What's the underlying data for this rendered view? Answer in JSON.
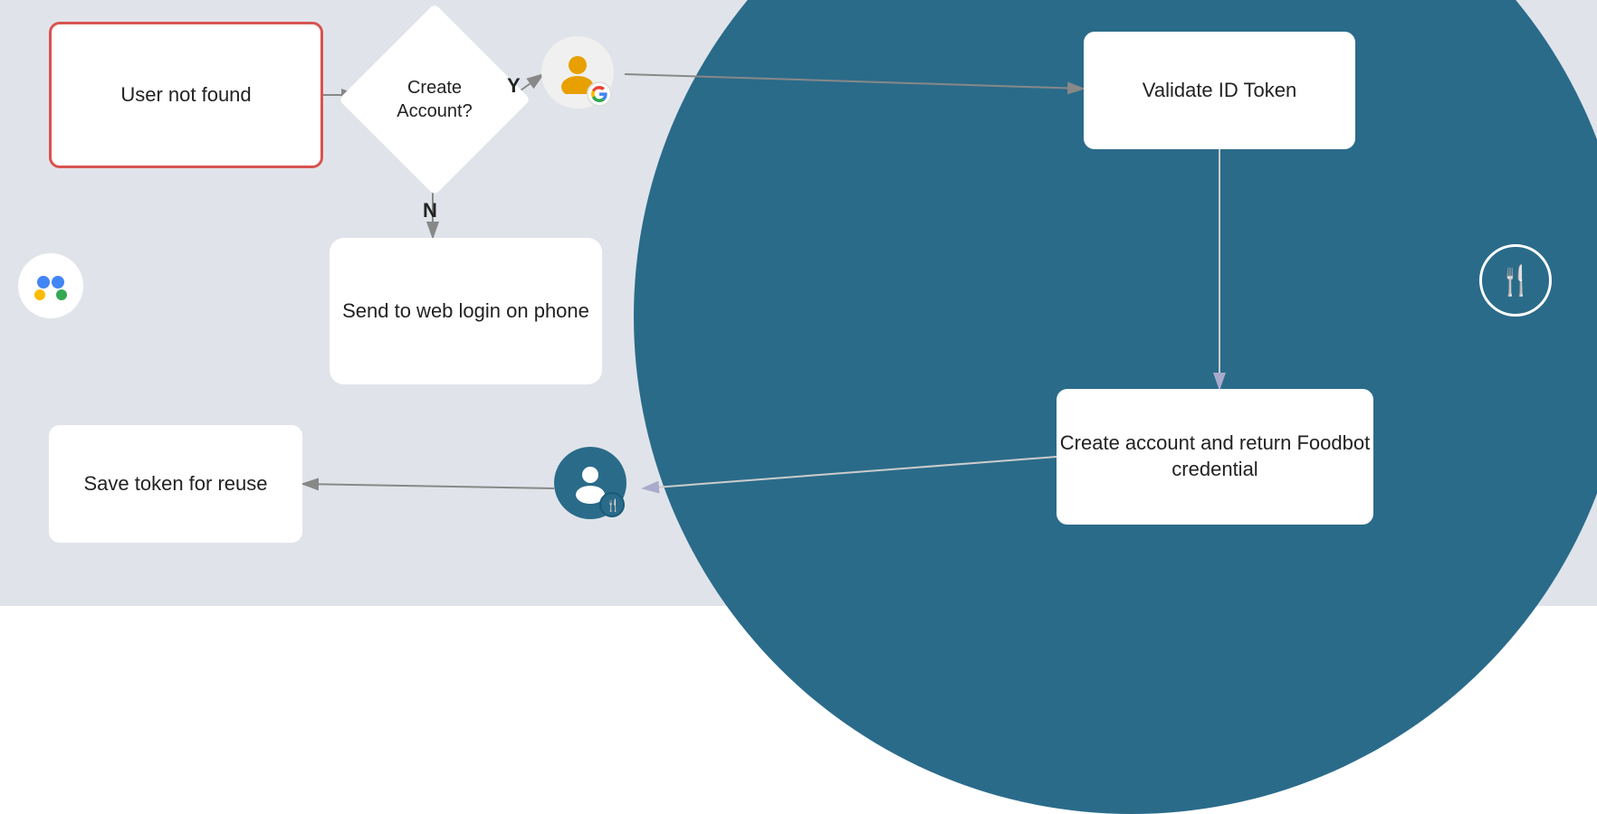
{
  "nodes": {
    "user_not_found": "User not found",
    "create_account_q": "Create\nAccount?",
    "send_to_web": "Send to web login on phone",
    "validate_id": "Validate ID Token",
    "create_account_return": "Create account and return Foodbot credential",
    "save_token": "Save token for reuse"
  },
  "labels": {
    "yes": "Y",
    "no": "N"
  },
  "icons": {
    "google_g": "G",
    "assistant": "●",
    "fork_knife": "🍴",
    "person": "👤"
  },
  "colors": {
    "bg_light": "#e0e4ea",
    "bg_dark": "#2a6b8a",
    "node_border_red": "#d9534f",
    "node_bg": "#ffffff"
  }
}
